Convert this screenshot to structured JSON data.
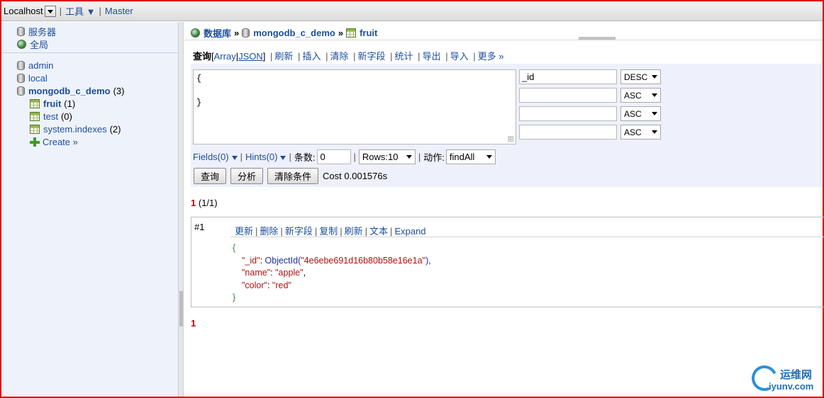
{
  "topbar": {
    "host": "Localhost",
    "tools": "工具 ▼",
    "master": "Master",
    "sep": "|"
  },
  "sidebar": {
    "top_items": [
      {
        "icon": "database-icon",
        "label": "服务器"
      },
      {
        "icon": "globe-icon",
        "label": "全局"
      }
    ],
    "databases": [
      {
        "label": "admin"
      },
      {
        "label": "local"
      },
      {
        "label": "mongodb_c_demo",
        "count": "(3)"
      }
    ],
    "collections": [
      {
        "label": "fruit",
        "count": "(1)"
      },
      {
        "label": "test",
        "count": "(0)"
      },
      {
        "label": "system.indexes",
        "count": "(2)"
      }
    ],
    "create": "Create »"
  },
  "breadcrumb": {
    "db_root": "数据库",
    "database": "mongodb_c_demo",
    "collection": "fruit",
    "arrow": "»"
  },
  "ops": {
    "query": "查询",
    "lbr": "[",
    "array": "Array",
    "pipe": "|",
    "json": "JSON",
    "rbr": "]",
    "refresh": "刷新",
    "insert": "插入",
    "clear": "清除",
    "new_field": "新字段",
    "stats": "统计",
    "export": "导出",
    "import": "导入",
    "more": "更多 »"
  },
  "query_panel": {
    "text_line1": "{",
    "text_line2": "}",
    "sort_rows": [
      {
        "field": "_id",
        "order": "DESC"
      },
      {
        "field": "",
        "order": "ASC"
      },
      {
        "field": "",
        "order": "ASC"
      },
      {
        "field": "",
        "order": "ASC"
      }
    ],
    "fields": "Fields(0)",
    "hints": "Hints(0)",
    "limit_label": "条数:",
    "limit_value": "0",
    "rows": "Rows:10",
    "action_label": "动作:",
    "action_value": "findAll",
    "btn_query": "查询",
    "btn_explain": "分析",
    "btn_clear": "清除条件",
    "cost": "Cost 0.001576s"
  },
  "pagination": {
    "page": "1",
    "total": "(1/1)",
    "footer_page": "1"
  },
  "result": {
    "index": "#1",
    "actions": [
      "更新",
      "删除",
      "新字段",
      "复制",
      "刷新",
      "文本",
      "Expand"
    ],
    "doc": {
      "open": "{",
      "id_key": "\"_id\"",
      "id_fn": "ObjectId(",
      "id_val": "\"4e6ebe691d16b80b58e16e1a\"",
      "id_close": "),",
      "name_key": "\"name\"",
      "name_val": "\"apple\"",
      "color_key": "\"color\"",
      "color_val": "\"red\"",
      "colon": ": ",
      "comma": ",",
      "close": "}"
    }
  },
  "watermark": {
    "title": "运维网",
    "domain": "iyunv.com"
  },
  "colors": {
    "link": "#1c4e9c",
    "sidebar_bg": "#eef2fb",
    "panel_bg": "#eef0fb",
    "red": "#c00000"
  }
}
